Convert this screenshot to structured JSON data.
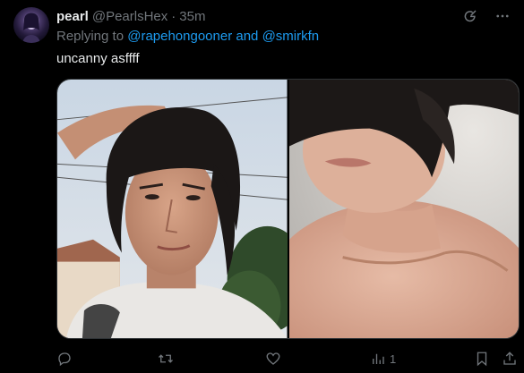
{
  "tweet": {
    "display_name": "pearl",
    "handle": "@PearlsHex",
    "separator": "·",
    "time": "35m",
    "reply": {
      "prefix": "Replying to ",
      "mention_1": "@rapehongooner",
      "joiner": " and ",
      "mention_2": "@smirkfn"
    },
    "text": "uncanny asffff",
    "media": [
      {
        "alt_name": "photo-left"
      },
      {
        "alt_name": "photo-right"
      }
    ],
    "actions": {
      "reply_count": "",
      "repost_count": "",
      "like_count": "",
      "views_count": "1"
    }
  },
  "colors": {
    "background": "#000000",
    "text_primary": "#e7e9ea",
    "text_secondary": "#71767b",
    "accent": "#1d9bf0",
    "border": "#2f3336"
  },
  "icons": {
    "top_right": [
      "grok-icon",
      "more-icon"
    ],
    "actions": [
      "reply-icon",
      "repost-icon",
      "like-icon",
      "views-icon",
      "bookmark-icon",
      "share-icon"
    ]
  }
}
